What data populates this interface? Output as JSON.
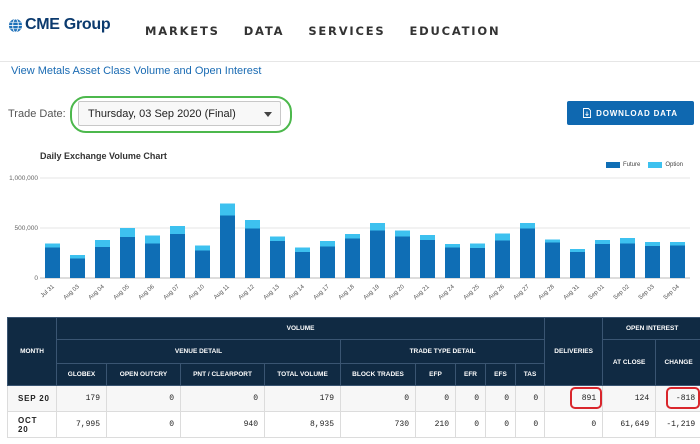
{
  "header": {
    "logo_text": "CME Group",
    "nav": [
      "MARKETS",
      "DATA",
      "SERVICES",
      "EDUCATION"
    ]
  },
  "asset_link": "View Metals Asset Class Volume and Open Interest",
  "trade_date": {
    "label": "Trade Date:",
    "value": "Thursday, 03 Sep 2020 (Final)"
  },
  "download_button": "DOWNLOAD DATA",
  "colors": {
    "future": "#0f6eb5",
    "option": "#3dc1ef",
    "header_bg": "#102a43",
    "button": "#0f68b0",
    "highlight_green": "#4cb84c",
    "highlight_red": "#d9262c"
  },
  "chart_data": {
    "type": "bar",
    "stacked": true,
    "title": "Daily Exchange Volume Chart",
    "categories": [
      "Jul 31",
      "Aug 03",
      "Aug 04",
      "Aug 05",
      "Aug 06",
      "Aug 07",
      "Aug 10",
      "Aug 11",
      "Aug 12",
      "Aug 13",
      "Aug 14",
      "Aug 17",
      "Aug 18",
      "Aug 19",
      "Aug 20",
      "Aug 21",
      "Aug 24",
      "Aug 25",
      "Aug 26",
      "Aug 27",
      "Aug 28",
      "Aug 31",
      "Sep 01",
      "Sep 02",
      "Sep 03",
      "Sep 04"
    ],
    "series": [
      {
        "name": "Future",
        "values": [
          305000,
          195000,
          310000,
          410000,
          345000,
          440000,
          275000,
          625000,
          495000,
          370000,
          260000,
          315000,
          395000,
          475000,
          415000,
          380000,
          305000,
          300000,
          375000,
          495000,
          355000,
          260000,
          340000,
          345000,
          320000,
          325000
        ]
      },
      {
        "name": "Option",
        "values": [
          40000,
          35000,
          70000,
          90000,
          80000,
          80000,
          50000,
          120000,
          85000,
          45000,
          45000,
          55000,
          45000,
          75000,
          60000,
          50000,
          35000,
          45000,
          70000,
          55000,
          30000,
          30000,
          40000,
          55000,
          40000,
          35000
        ]
      }
    ],
    "yticks": [
      "1,000,000",
      "500,000",
      "0"
    ],
    "ylim": [
      0,
      1000000
    ],
    "legend": "top-right",
    "grid": true
  },
  "table": {
    "group_headers": {
      "month": "MONTH",
      "volume": "VOLUME",
      "venue_detail": "VENUE DETAIL",
      "trade_type_detail": "TRADE TYPE DETAIL",
      "deliveries": "DELIVERIES",
      "open_interest": "OPEN INTEREST"
    },
    "columns": [
      "GLOBEX",
      "OPEN OUTCRY",
      "PNT / CLEARPORT",
      "TOTAL VOLUME",
      "BLOCK TRADES",
      "EFP",
      "EFR",
      "EFS",
      "TAS",
      "AT CLOSE",
      "CHANGE"
    ],
    "rows": [
      {
        "month": "SEP 20",
        "globex": "179",
        "open_outcry": "0",
        "pnt": "0",
        "total": "179",
        "block": "0",
        "efp": "0",
        "efr": "0",
        "efs": "0",
        "tas": "0",
        "deliveries": "891",
        "at_close": "124",
        "change": "-818"
      },
      {
        "month": "OCT 20",
        "globex": "7,995",
        "open_outcry": "0",
        "pnt": "940",
        "total": "8,935",
        "block": "730",
        "efp": "210",
        "efr": "0",
        "efs": "0",
        "tas": "0",
        "deliveries": "0",
        "at_close": "61,649",
        "change": "-1,219"
      }
    ]
  }
}
